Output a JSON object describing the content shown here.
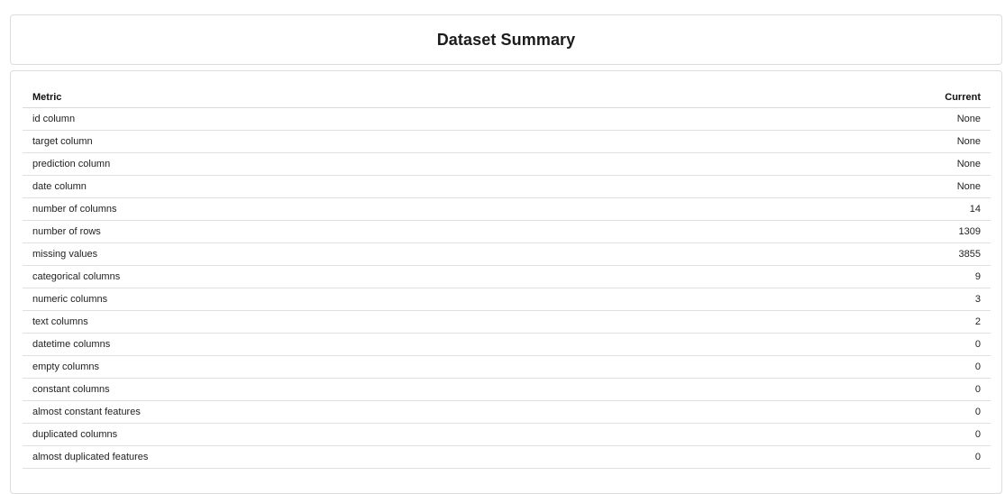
{
  "header": {
    "title": "Dataset Summary"
  },
  "table": {
    "columns": [
      "Metric",
      "Current"
    ],
    "rows": [
      [
        "id column",
        "None"
      ],
      [
        "target column",
        "None"
      ],
      [
        "prediction column",
        "None"
      ],
      [
        "date column",
        "None"
      ],
      [
        "number of columns",
        "14"
      ],
      [
        "number of rows",
        "1309"
      ],
      [
        "missing values",
        "3855"
      ],
      [
        "categorical columns",
        "9"
      ],
      [
        "numeric columns",
        "3"
      ],
      [
        "text columns",
        "2"
      ],
      [
        "datetime columns",
        "0"
      ],
      [
        "empty columns",
        "0"
      ],
      [
        "constant columns",
        "0"
      ],
      [
        "almost constant features",
        "0"
      ],
      [
        "duplicated columns",
        "0"
      ],
      [
        "almost duplicated features",
        "0"
      ]
    ]
  }
}
